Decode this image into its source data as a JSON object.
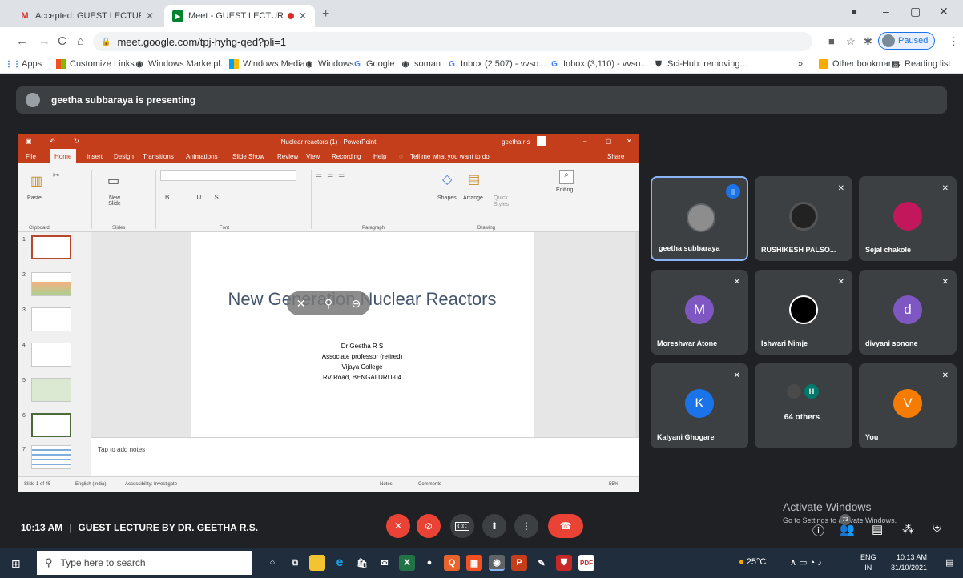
{
  "browser": {
    "tabs": [
      {
        "title": "Accepted: GUEST LECTURE BY DR",
        "icon": "gmail-icon"
      },
      {
        "title": "Meet - GUEST LECTURE BY D",
        "icon": "meet-icon"
      }
    ],
    "url": "meet.google.com/tpj-hyhg-qed?pli=1",
    "profile_label": "Paused",
    "bookmarks": [
      "Apps",
      "Customize Links",
      "Windows Marketpl...",
      "Windows Media",
      "Windows",
      "Google",
      "soman",
      "Inbox (2,507) - vvso...",
      "Inbox (3,110) - vvso...",
      "Sci-Hub: removing..."
    ],
    "bookmarks_more": "»",
    "other_bookmarks": "Other bookmarks",
    "reading_list": "Reading list"
  },
  "meet": {
    "presenting_label": "geetha subbaraya is presenting",
    "time": "10:13 AM",
    "meeting_title": "GUEST LECTURE BY DR. GEETHA R.S.",
    "participant_count": "73",
    "participants": [
      {
        "name": "geetha subbaraya",
        "speaking": true,
        "avatar": "photo"
      },
      {
        "name": "RUSHIKESH PALSO...",
        "muted": true,
        "avatar": "photo"
      },
      {
        "name": "Sejal chakole",
        "muted": true,
        "avatar": "photo"
      },
      {
        "name": "Moreshwar Atone",
        "muted": true,
        "initial": "M",
        "color": "#7e57c2"
      },
      {
        "name": "Ishwari Nimje",
        "muted": true,
        "avatar": "photo"
      },
      {
        "name": "divyani sonone",
        "muted": true,
        "initial": "d",
        "color": "#7e57c2"
      },
      {
        "name": "Kalyani Ghogare",
        "muted": true,
        "initial": "K",
        "color": "#1a73e8"
      },
      {
        "name": "64 others",
        "initial": "H",
        "color": "#00796b"
      },
      {
        "name": "You",
        "muted": true,
        "initial": "V",
        "color": "#f57c00"
      }
    ],
    "watermark_title": "Activate Windows",
    "watermark_sub": "Go to Settings to activate Windows."
  },
  "powerpoint": {
    "window_title": "Nuclear reactors (1) - PowerPoint",
    "user": "geetha r s",
    "menu": [
      "File",
      "Home",
      "Insert",
      "Design",
      "Transitions",
      "Animations",
      "Slide Show",
      "Review",
      "View",
      "Recording",
      "Help"
    ],
    "tell_me": "Tell me what you want to do",
    "share": "Share",
    "ribbon_groups": [
      "Clipboard",
      "Slides",
      "Font",
      "Paragraph",
      "Drawing"
    ],
    "ribbon_buttons": {
      "paste": "Paste",
      "new_slide": "New Slide",
      "shapes": "Shapes",
      "arrange": "Arrange",
      "quick_styles": "Quick Styles",
      "editing": "Editing"
    },
    "slide_title": "New Generation Nuclear Reactors",
    "slide_lines": [
      "Dr Geetha R S",
      "Associate professor (retired)",
      "Vijaya College",
      "RV Road, BENGALURU-04"
    ],
    "notes_placeholder": "Tap to add notes",
    "status": {
      "slide": "Slide 1 of 45",
      "lang": "English (India)",
      "access": "Accessibility: Investigate",
      "notes": "Notes",
      "comments": "Comments",
      "zoom": "55%"
    },
    "thumbnail_numbers": [
      "1",
      "2",
      "3",
      "4",
      "5",
      "6",
      "7"
    ]
  },
  "taskbar": {
    "search_placeholder": "Type here to search",
    "temperature": "25°C",
    "lang1": "ENG",
    "lang2": "IN",
    "time": "10:13 AM",
    "date": "31/10/2021"
  }
}
